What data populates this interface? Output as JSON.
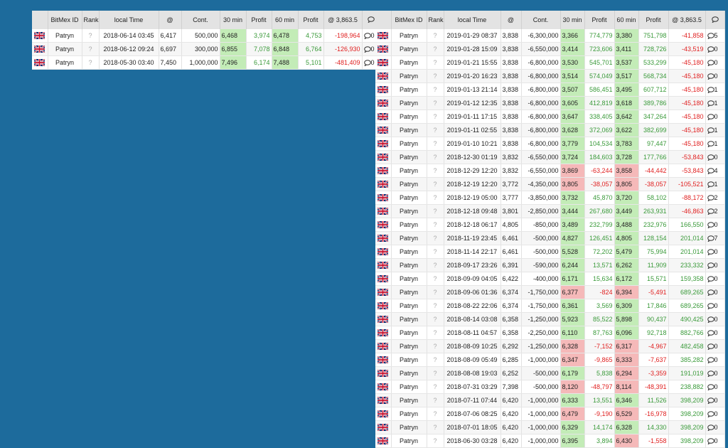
{
  "headers": {
    "flag": "",
    "bitmex_id": "BitMex ID",
    "rank": "Rank",
    "local_time": "local Time",
    "at": "@",
    "cont": "Cont.",
    "m30": "30 min",
    "profit30": "Profit",
    "m60": "60 min",
    "profit60": "Profit",
    "at_current": "@ 3,863.5",
    "comments": ""
  },
  "colors": {
    "background": "#1d6b9c",
    "positive_text": "#3a9a3a",
    "negative_text": "#e02020",
    "positive_cell": "#c3ecb7",
    "negative_cell": "#f5b9b9"
  },
  "left_rows": [
    {
      "name": "Patryn",
      "rank": "?",
      "time": "2018-06-14 03:45",
      "at": "6,417",
      "cont": "500,000",
      "m30": "6,468",
      "m30c": "g",
      "p30": "3,974",
      "p30c": "g",
      "m60": "6,478",
      "m60c": "g",
      "p60": "4,753",
      "p60c": "g",
      "atc": "-198,964",
      "atcc": "r",
      "cm": "0"
    },
    {
      "name": "Patryn",
      "rank": "?",
      "time": "2018-06-12 09:24",
      "at": "6,697",
      "cont": "300,000",
      "m30": "6,855",
      "m30c": "g",
      "p30": "7,078",
      "p30c": "g",
      "m60": "6,848",
      "m60c": "g",
      "p60": "6,764",
      "p60c": "g",
      "atc": "-126,930",
      "atcc": "r",
      "cm": "0"
    },
    {
      "name": "Patryn",
      "rank": "?",
      "time": "2018-05-30 03:40",
      "at": "7,450",
      "cont": "1,000,000",
      "m30": "7,496",
      "m30c": "g",
      "p30": "6,174",
      "p30c": "g",
      "m60": "7,488",
      "m60c": "g",
      "p60": "5,101",
      "p60c": "g",
      "atc": "-481,409",
      "atcc": "r",
      "cm": "0"
    }
  ],
  "right_rows": [
    {
      "name": "Patryn",
      "rank": "?",
      "time": "2019-01-29 08:37",
      "at": "3,838",
      "cont": "-6,300,000",
      "m30": "3,366",
      "m30c": "g",
      "p30": "774,779",
      "p30c": "g",
      "m60": "3,380",
      "m60c": "g",
      "p60": "751,798",
      "p60c": "g",
      "atc": "-41,858",
      "atcc": "r",
      "cm": "5"
    },
    {
      "name": "Patryn",
      "rank": "?",
      "time": "2019-01-28 15:09",
      "at": "3,838",
      "cont": "-6,550,000",
      "m30": "3,414",
      "m30c": "g",
      "p30": "723,606",
      "p30c": "g",
      "m60": "3,411",
      "m60c": "g",
      "p60": "728,726",
      "p60c": "g",
      "atc": "-43,519",
      "atcc": "r",
      "cm": "0"
    },
    {
      "name": "Patryn",
      "rank": "?",
      "time": "2019-01-21 15:55",
      "at": "3,838",
      "cont": "-6,800,000",
      "m30": "3,530",
      "m30c": "g",
      "p30": "545,701",
      "p30c": "g",
      "m60": "3,537",
      "m60c": "g",
      "p60": "533,299",
      "p60c": "g",
      "atc": "-45,180",
      "atcc": "r",
      "cm": "0"
    },
    {
      "name": "Patryn",
      "rank": "?",
      "time": "2019-01-20 16:23",
      "at": "3,838",
      "cont": "-6,800,000",
      "m30": "3,514",
      "m30c": "g",
      "p30": "574,049",
      "p30c": "g",
      "m60": "3,517",
      "m60c": "g",
      "p60": "568,734",
      "p60c": "g",
      "atc": "-45,180",
      "atcc": "r",
      "cm": "0"
    },
    {
      "name": "Patryn",
      "rank": "?",
      "time": "2019-01-13 21:14",
      "at": "3,838",
      "cont": "-6,800,000",
      "m30": "3,507",
      "m30c": "g",
      "p30": "586,451",
      "p30c": "g",
      "m60": "3,495",
      "m60c": "g",
      "p60": "607,712",
      "p60c": "g",
      "atc": "-45,180",
      "atcc": "r",
      "cm": "1"
    },
    {
      "name": "Patryn",
      "rank": "?",
      "time": "2019-01-12 12:35",
      "at": "3,838",
      "cont": "-6,800,000",
      "m30": "3,605",
      "m30c": "g",
      "p30": "412,819",
      "p30c": "g",
      "m60": "3,618",
      "m60c": "g",
      "p60": "389,786",
      "p60c": "g",
      "atc": "-45,180",
      "atcc": "r",
      "cm": "1"
    },
    {
      "name": "Patryn",
      "rank": "?",
      "time": "2019-01-11 17:15",
      "at": "3,838",
      "cont": "-6,800,000",
      "m30": "3,647",
      "m30c": "g",
      "p30": "338,405",
      "p30c": "g",
      "m60": "3,642",
      "m60c": "g",
      "p60": "347,264",
      "p60c": "g",
      "atc": "-45,180",
      "atcc": "r",
      "cm": "0"
    },
    {
      "name": "Patryn",
      "rank": "?",
      "time": "2019-01-11 02:55",
      "at": "3,838",
      "cont": "-6,800,000",
      "m30": "3,628",
      "m30c": "g",
      "p30": "372,069",
      "p30c": "g",
      "m60": "3,622",
      "m60c": "g",
      "p60": "382,699",
      "p60c": "g",
      "atc": "-45,180",
      "atcc": "r",
      "cm": "1"
    },
    {
      "name": "Patryn",
      "rank": "?",
      "time": "2019-01-10 10:21",
      "at": "3,838",
      "cont": "-6,800,000",
      "m30": "3,779",
      "m30c": "g",
      "p30": "104,534",
      "p30c": "g",
      "m60": "3,783",
      "m60c": "g",
      "p60": "97,447",
      "p60c": "g",
      "atc": "-45,180",
      "atcc": "r",
      "cm": "1"
    },
    {
      "name": "Patryn",
      "rank": "?",
      "time": "2018-12-30 01:19",
      "at": "3,832",
      "cont": "-6,550,000",
      "m30": "3,724",
      "m30c": "g",
      "p30": "184,603",
      "p30c": "g",
      "m60": "3,728",
      "m60c": "g",
      "p60": "177,766",
      "p60c": "g",
      "atc": "-53,843",
      "atcc": "r",
      "cm": "0"
    },
    {
      "name": "Patryn",
      "rank": "?",
      "time": "2018-12-29 12:20",
      "at": "3,832",
      "cont": "-6,550,000",
      "m30": "3,869",
      "m30c": "r",
      "p30": "-63,244",
      "p30c": "r",
      "m60": "3,858",
      "m60c": "r",
      "p60": "-44,442",
      "p60c": "r",
      "atc": "-53,843",
      "atcc": "r",
      "cm": "4"
    },
    {
      "name": "Patryn",
      "rank": "?",
      "time": "2018-12-19 12:20",
      "at": "3,772",
      "cont": "-4,350,000",
      "m30": "3,805",
      "m30c": "r",
      "p30": "-38,057",
      "p30c": "r",
      "m60": "3,805",
      "m60c": "r",
      "p60": "-38,057",
      "p60c": "r",
      "atc": "-105,521",
      "atcc": "r",
      "cm": "1"
    },
    {
      "name": "Patryn",
      "rank": "?",
      "time": "2018-12-19 05:00",
      "at": "3,777",
      "cont": "-3,850,000",
      "m30": "3,732",
      "m30c": "g",
      "p30": "45,870",
      "p30c": "g",
      "m60": "3,720",
      "m60c": "g",
      "p60": "58,102",
      "p60c": "g",
      "atc": "-88,172",
      "atcc": "r",
      "cm": "2"
    },
    {
      "name": "Patryn",
      "rank": "?",
      "time": "2018-12-18 09:48",
      "at": "3,801",
      "cont": "-2,850,000",
      "m30": "3,444",
      "m30c": "g",
      "p30": "267,680",
      "p30c": "g",
      "m60": "3,449",
      "m60c": "g",
      "p60": "263,931",
      "p60c": "g",
      "atc": "-46,863",
      "atcc": "r",
      "cm": "2"
    },
    {
      "name": "Patryn",
      "rank": "?",
      "time": "2018-12-18 06:17",
      "at": "4,805",
      "cont": "-850,000",
      "m30": "3,489",
      "m30c": "g",
      "p30": "232,799",
      "p30c": "g",
      "m60": "3,488",
      "m60c": "g",
      "p60": "232,976",
      "p60c": "g",
      "atc": "166,550",
      "atcc": "g",
      "cm": "0"
    },
    {
      "name": "Patryn",
      "rank": "?",
      "time": "2018-11-19 23:45",
      "at": "6,461",
      "cont": "-500,000",
      "m30": "4,827",
      "m30c": "g",
      "p30": "126,451",
      "p30c": "g",
      "m60": "4,805",
      "m60c": "g",
      "p60": "128,154",
      "p60c": "g",
      "atc": "201,014",
      "atcc": "g",
      "cm": "7"
    },
    {
      "name": "Patryn",
      "rank": "?",
      "time": "2018-11-14 22:17",
      "at": "6,461",
      "cont": "-500,000",
      "m30": "5,528",
      "m30c": "g",
      "p30": "72,202",
      "p30c": "g",
      "m60": "5,479",
      "m60c": "g",
      "p60": "75,994",
      "p60c": "g",
      "atc": "201,014",
      "atcc": "g",
      "cm": "0"
    },
    {
      "name": "Patryn",
      "rank": "?",
      "time": "2018-09-17 23:26",
      "at": "6,391",
      "cont": "-590,000",
      "m30": "6,244",
      "m30c": "g",
      "p30": "13,571",
      "p30c": "g",
      "m60": "6,262",
      "m60c": "g",
      "p60": "11,909",
      "p60c": "g",
      "atc": "233,332",
      "atcc": "g",
      "cm": "0"
    },
    {
      "name": "Patryn",
      "rank": "?",
      "time": "2018-09-09 04:05",
      "at": "6,422",
      "cont": "-400,000",
      "m30": "6,171",
      "m30c": "g",
      "p30": "15,634",
      "p30c": "g",
      "m60": "6,172",
      "m60c": "g",
      "p60": "15,571",
      "p60c": "g",
      "atc": "159,358",
      "atcc": "g",
      "cm": "0"
    },
    {
      "name": "Patryn",
      "rank": "?",
      "time": "2018-09-06 01:36",
      "at": "6,374",
      "cont": "-1,750,000",
      "m30": "6,377",
      "m30c": "r",
      "p30": "-824",
      "p30c": "r",
      "m60": "6,394",
      "m60c": "r",
      "p60": "-5,491",
      "p60c": "r",
      "atc": "689,265",
      "atcc": "g",
      "cm": "0"
    },
    {
      "name": "Patryn",
      "rank": "?",
      "time": "2018-08-22 22:06",
      "at": "6,374",
      "cont": "-1,750,000",
      "m30": "6,361",
      "m30c": "g",
      "p30": "3,569",
      "p30c": "g",
      "m60": "6,309",
      "m60c": "g",
      "p60": "17,846",
      "p60c": "g",
      "atc": "689,265",
      "atcc": "g",
      "cm": "0"
    },
    {
      "name": "Patryn",
      "rank": "?",
      "time": "2018-08-14 03:08",
      "at": "6,358",
      "cont": "-1,250,000",
      "m30": "5,923",
      "m30c": "g",
      "p30": "85,522",
      "p30c": "g",
      "m60": "5,898",
      "m60c": "g",
      "p60": "90,437",
      "p60c": "g",
      "atc": "490,425",
      "atcc": "g",
      "cm": "0"
    },
    {
      "name": "Patryn",
      "rank": "?",
      "time": "2018-08-11 04:57",
      "at": "6,358",
      "cont": "-2,250,000",
      "m30": "6,110",
      "m30c": "g",
      "p30": "87,763",
      "p30c": "g",
      "m60": "6,096",
      "m60c": "g",
      "p60": "92,718",
      "p60c": "g",
      "atc": "882,766",
      "atcc": "g",
      "cm": "0"
    },
    {
      "name": "Patryn",
      "rank": "?",
      "time": "2018-08-09 10:25",
      "at": "6,292",
      "cont": "-1,250,000",
      "m30": "6,328",
      "m30c": "r",
      "p30": "-7,152",
      "p30c": "r",
      "m60": "6,317",
      "m60c": "r",
      "p60": "-4,967",
      "p60c": "r",
      "atc": "482,458",
      "atcc": "g",
      "cm": "0"
    },
    {
      "name": "Patryn",
      "rank": "?",
      "time": "2018-08-09 05:49",
      "at": "6,285",
      "cont": "-1,000,000",
      "m30": "6,347",
      "m30c": "r",
      "p30": "-9,865",
      "p30c": "r",
      "m60": "6,333",
      "m60c": "r",
      "p60": "-7,637",
      "p60c": "r",
      "atc": "385,282",
      "atcc": "g",
      "cm": "0"
    },
    {
      "name": "Patryn",
      "rank": "?",
      "time": "2018-08-08 19:03",
      "at": "6,252",
      "cont": "-500,000",
      "m30": "6,179",
      "m30c": "g",
      "p30": "5,838",
      "p30c": "g",
      "m60": "6,294",
      "m60c": "r",
      "p60": "-3,359",
      "p60c": "r",
      "atc": "191,019",
      "atcc": "g",
      "cm": "0"
    },
    {
      "name": "Patryn",
      "rank": "?",
      "time": "2018-07-31 03:29",
      "at": "7,398",
      "cont": "-500,000",
      "m30": "8,120",
      "m30c": "r",
      "p30": "-48,797",
      "p30c": "r",
      "m60": "8,114",
      "m60c": "r",
      "p60": "-48,391",
      "p60c": "r",
      "atc": "238,882",
      "atcc": "g",
      "cm": "0"
    },
    {
      "name": "Patryn",
      "rank": "?",
      "time": "2018-07-11 07:44",
      "at": "6,420",
      "cont": "-1,000,000",
      "m30": "6,333",
      "m30c": "g",
      "p30": "13,551",
      "p30c": "g",
      "m60": "6,346",
      "m60c": "g",
      "p60": "11,526",
      "p60c": "g",
      "atc": "398,209",
      "atcc": "g",
      "cm": "0"
    },
    {
      "name": "Patryn",
      "rank": "?",
      "time": "2018-07-06 08:25",
      "at": "6,420",
      "cont": "-1,000,000",
      "m30": "6,479",
      "m30c": "r",
      "p30": "-9,190",
      "p30c": "r",
      "m60": "6,529",
      "m60c": "r",
      "p60": "-16,978",
      "p60c": "r",
      "atc": "398,209",
      "atcc": "g",
      "cm": "0"
    },
    {
      "name": "Patryn",
      "rank": "?",
      "time": "2018-07-01 18:05",
      "at": "6,420",
      "cont": "-1,000,000",
      "m30": "6,329",
      "m30c": "g",
      "p30": "14,174",
      "p30c": "g",
      "m60": "6,328",
      "m60c": "g",
      "p60": "14,330",
      "p60c": "g",
      "atc": "398,209",
      "atcc": "g",
      "cm": "0"
    },
    {
      "name": "Patryn",
      "rank": "?",
      "time": "2018-06-30 03:28",
      "at": "6,420",
      "cont": "-1,000,000",
      "m30": "6,395",
      "m30c": "g",
      "p30": "3,894",
      "p30c": "g",
      "m60": "6,430",
      "m60c": "r",
      "p60": "-1,558",
      "p60c": "r",
      "atc": "398,209",
      "atcc": "g",
      "cm": "0"
    }
  ]
}
